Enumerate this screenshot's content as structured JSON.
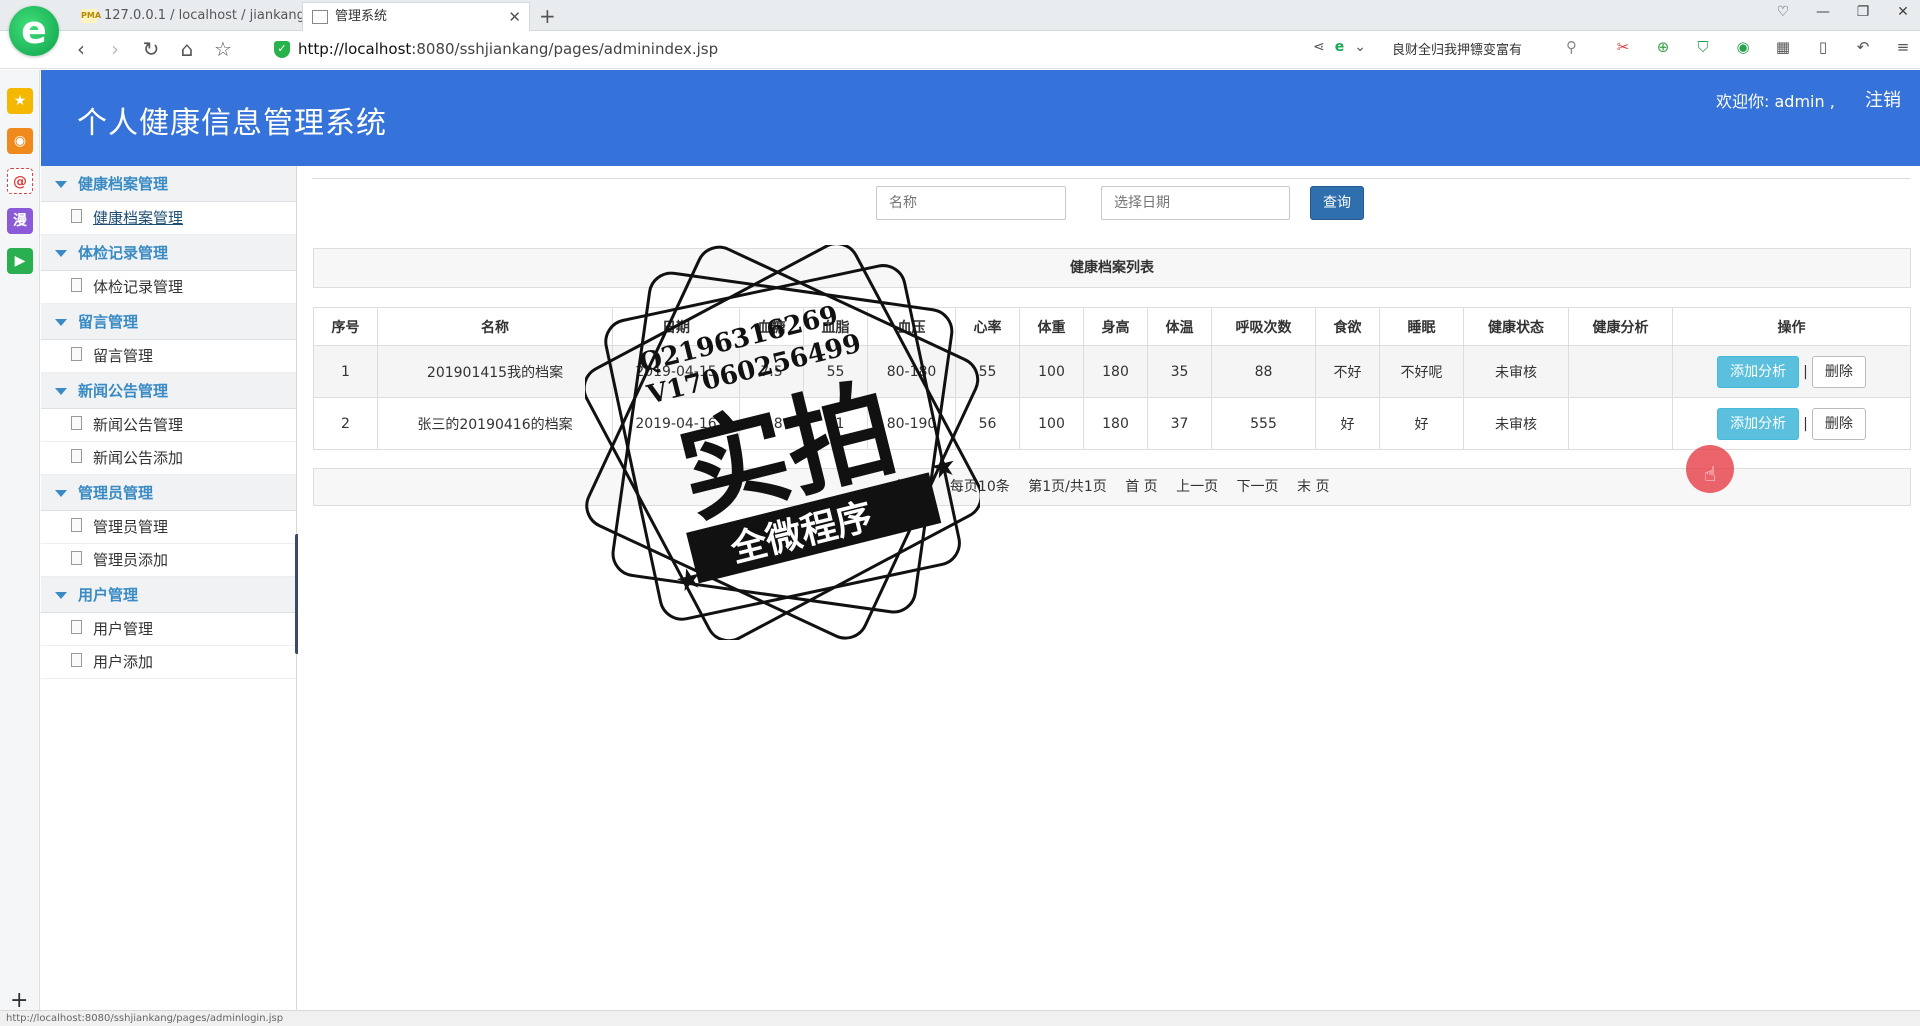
{
  "browser": {
    "tabs": [
      {
        "label": "127.0.0.1 / localhost / jiankang",
        "icon": "PMA"
      },
      {
        "label": "管理系统"
      }
    ],
    "new_tab": "+",
    "url_host": "http://localhost",
    "url_rest": ":8080/sshjiankang/pages/adminindex.jsp",
    "search_text": "良财全归我押镖变富有",
    "status_url": "http://localhost:8080/sshjiankang/pages/adminlogin.jsp"
  },
  "app": {
    "title": "个人健康信息管理系统",
    "welcome": "欢迎你: admin ,",
    "logout": "注销"
  },
  "menu": [
    {
      "group": "健康档案管理",
      "items": [
        "健康档案管理"
      ]
    },
    {
      "group": "体检记录管理",
      "items": [
        "体检记录管理"
      ]
    },
    {
      "group": "留言管理",
      "items": [
        "留言管理"
      ]
    },
    {
      "group": "新闻公告管理",
      "items": [
        "新闻公告管理",
        "新闻公告添加"
      ]
    },
    {
      "group": "管理员管理",
      "items": [
        "管理员管理",
        "管理员添加"
      ]
    },
    {
      "group": "用户管理",
      "items": [
        "用户管理",
        "用户添加"
      ]
    }
  ],
  "search": {
    "name_placeholder": "名称",
    "date_placeholder": "选择日期",
    "query_label": "查询"
  },
  "list": {
    "title": "健康档案列表",
    "columns": [
      "序号",
      "名称",
      "日期",
      "血糖",
      "血脂",
      "血压",
      "心率",
      "体重",
      "身高",
      "体温",
      "呼吸次数",
      "食欲",
      "睡眠",
      "健康状态",
      "健康分析",
      "操作"
    ],
    "rows": [
      [
        "1",
        "201901415我的档案",
        "2019-04-15",
        "7.5",
        "55",
        "80-180",
        "55",
        "100",
        "180",
        "35",
        "88",
        "不好",
        "不好呢",
        "未审核",
        ""
      ],
      [
        "2",
        "张三的20190416的档案",
        "2019-04-16",
        "5.8",
        "51",
        "80-190",
        "56",
        "100",
        "180",
        "37",
        "555",
        "好",
        "好",
        "未审核",
        ""
      ]
    ],
    "action_analysis": "添加分析",
    "action_sep": "|",
    "action_delete": "删除"
  },
  "pager": {
    "total": "共2条",
    "page_info": "每页10条",
    "current": "第1页/共1页",
    "first": "首 页",
    "prev": "上一页",
    "next": "下一页",
    "last": "末 页"
  },
  "watermark": {
    "line1": "Q2196316269",
    "line2": "V17060256499",
    "big": "实拍",
    "banner": "全微程序"
  },
  "colors": {
    "header": "#3572d9",
    "menu_text": "#3a8bc4",
    "query_button": "#2f6fad",
    "analysis_button": "#5bc0de"
  }
}
